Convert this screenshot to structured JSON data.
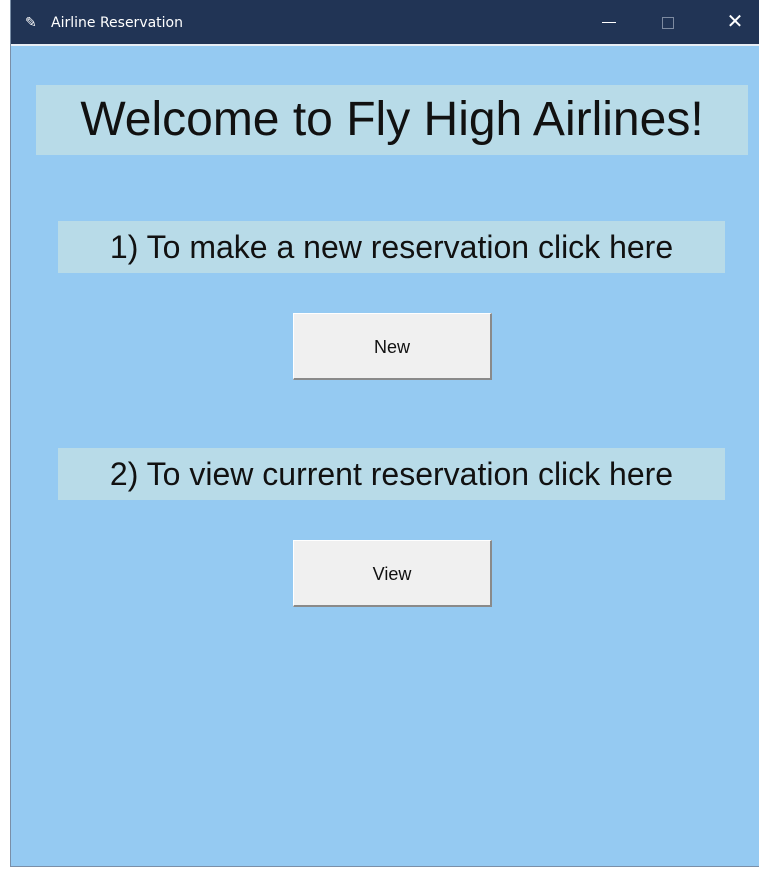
{
  "window": {
    "title": "Airline Reservation",
    "controls": {
      "minimize_icon": "minimize-icon",
      "maximize_icon": "maximize-icon",
      "close_icon": "close-icon",
      "close_glyph": "✕"
    },
    "app_icon": "feather-icon",
    "app_icon_glyph": "✎"
  },
  "main": {
    "welcome": "Welcome to Fly High Airlines!",
    "prompt_new": "1) To make a new reservation click here",
    "new_button": "New",
    "prompt_view": "2) To view current reservation click here",
    "view_button": "View"
  },
  "colors": {
    "titlebar": "#213455",
    "background": "#95caf2",
    "label_background": "#b8dbe8",
    "button": "#f0f0f0"
  }
}
